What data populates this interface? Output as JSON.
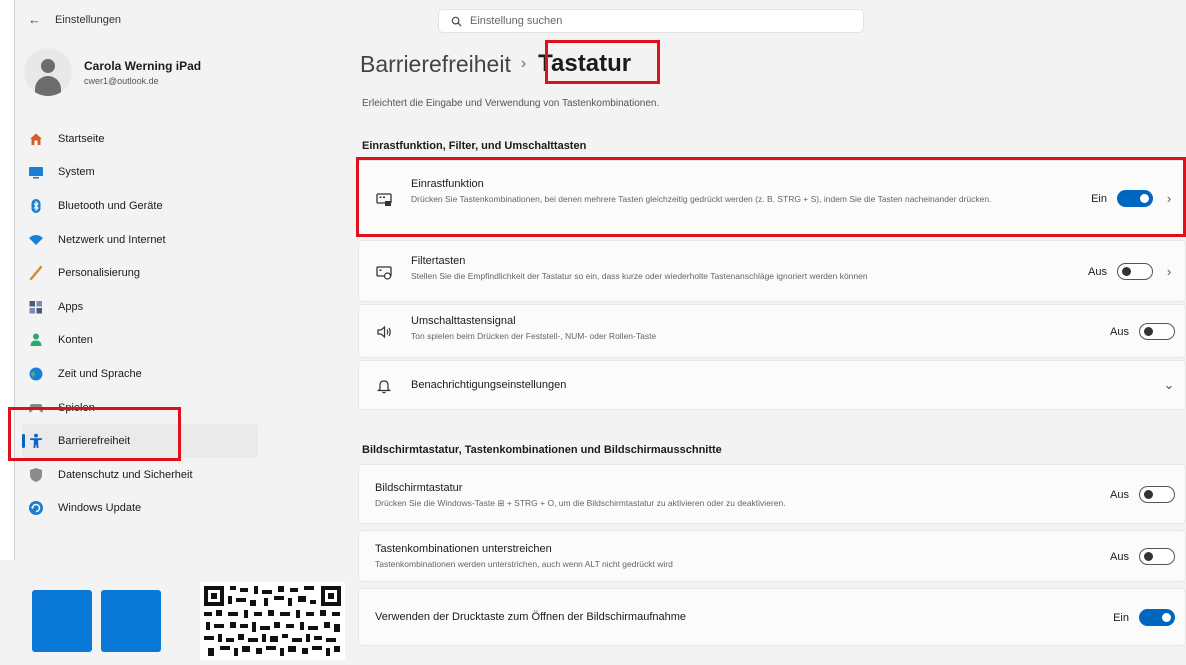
{
  "header": {
    "back_icon": "back-arrow-icon",
    "app_title": "Einstellungen"
  },
  "search": {
    "placeholder": "Einstellung suchen",
    "icon": "search-icon"
  },
  "user": {
    "name": "Carola Werning iPad",
    "email": "cwer1@outlook.de"
  },
  "sidebar": {
    "items": [
      {
        "label": "Startseite",
        "icon": "home-icon",
        "color": "#d45b2b"
      },
      {
        "label": "System",
        "icon": "monitor-icon",
        "color": "#1a7fd4"
      },
      {
        "label": "Bluetooth und Geräte",
        "icon": "bluetooth-icon",
        "color": "#1a7fd4"
      },
      {
        "label": "Netzwerk und Internet",
        "icon": "wifi-icon",
        "color": "#1a7fd4"
      },
      {
        "label": "Personalisierung",
        "icon": "brush-icon",
        "color": "#d48a2b"
      },
      {
        "label": "Apps",
        "icon": "apps-icon",
        "color": "#4a5a78"
      },
      {
        "label": "Konten",
        "icon": "account-icon",
        "color": "#2ba86e"
      },
      {
        "label": "Zeit und Sprache",
        "icon": "globe-clock-icon",
        "color": "#1a7fd4"
      },
      {
        "label": "Spielen",
        "icon": "gamepad-icon",
        "color": "#777777"
      },
      {
        "label": "Barrierefreiheit",
        "icon": "accessibility-icon",
        "color": "#0a63c4",
        "active": true
      },
      {
        "label": "Datenschutz und Sicherheit",
        "icon": "shield-icon",
        "color": "#777777"
      },
      {
        "label": "Windows Update",
        "icon": "update-icon",
        "color": "#1a7fd4"
      }
    ]
  },
  "breadcrumb": {
    "parent": "Barrierefreiheit",
    "separator": "›",
    "current": "Tastatur"
  },
  "subtitle": "Erleichtert die Eingabe und Verwendung von Tastenkombinationen.",
  "sections": [
    {
      "heading": "Einrastfunktion, Filter, und Umschalttasten",
      "cards": [
        {
          "title": "Einrastfunktion",
          "desc": "Drücken Sie Tastenkombinationen, bei denen mehrere Tasten gleichzeitig gedrückt werden (z. B. STRG + S), indem Sie die Tasten nacheinander drücken.",
          "icon": "sticky-keys-icon",
          "state": "Ein",
          "on": true,
          "chevron": "›"
        },
        {
          "title": "Filtertasten",
          "desc": "Stellen Sie die Empfindlichkeit der Tastatur so ein, dass kurze oder wiederholte Tastenanschläge ignoriert werden können",
          "icon": "filter-keys-icon",
          "state": "Aus",
          "on": false,
          "chevron": "›"
        },
        {
          "title": "Umschalttastensignal",
          "desc": "Ton spielen beim Drücken der Feststell-, NUM- oder Rollen-Taste",
          "icon": "speaker-icon",
          "state": "Aus",
          "on": false
        },
        {
          "title": "Benachrichtigungseinstellungen",
          "icon": "bell-icon",
          "chevron": "⌄"
        }
      ]
    },
    {
      "heading": "Bildschirmtastatur, Tastenkombinationen und Bildschirmausschnitte",
      "cards": [
        {
          "title": "Bildschirmtastatur",
          "desc": "Drücken Sie die Windows-Taste ⊞ + STRG + O, um die Bildschirmtastatur zu aktivieren oder zu deaktivieren.",
          "state": "Aus",
          "on": false
        },
        {
          "title": "Tastenkombinationen unterstreichen",
          "desc": "Tastenkombinationen werden unterstrichen, auch wenn ALT nicht gedrückt wird",
          "state": "Aus",
          "on": false
        },
        {
          "title": "Verwenden der Drucktaste zum Öffnen der Bildschirmaufnahme",
          "state": "Ein",
          "on": true
        }
      ]
    }
  ],
  "colors": {
    "accent": "#0067c0",
    "highlight": "#e0101a",
    "logo": "#0a78d7"
  }
}
